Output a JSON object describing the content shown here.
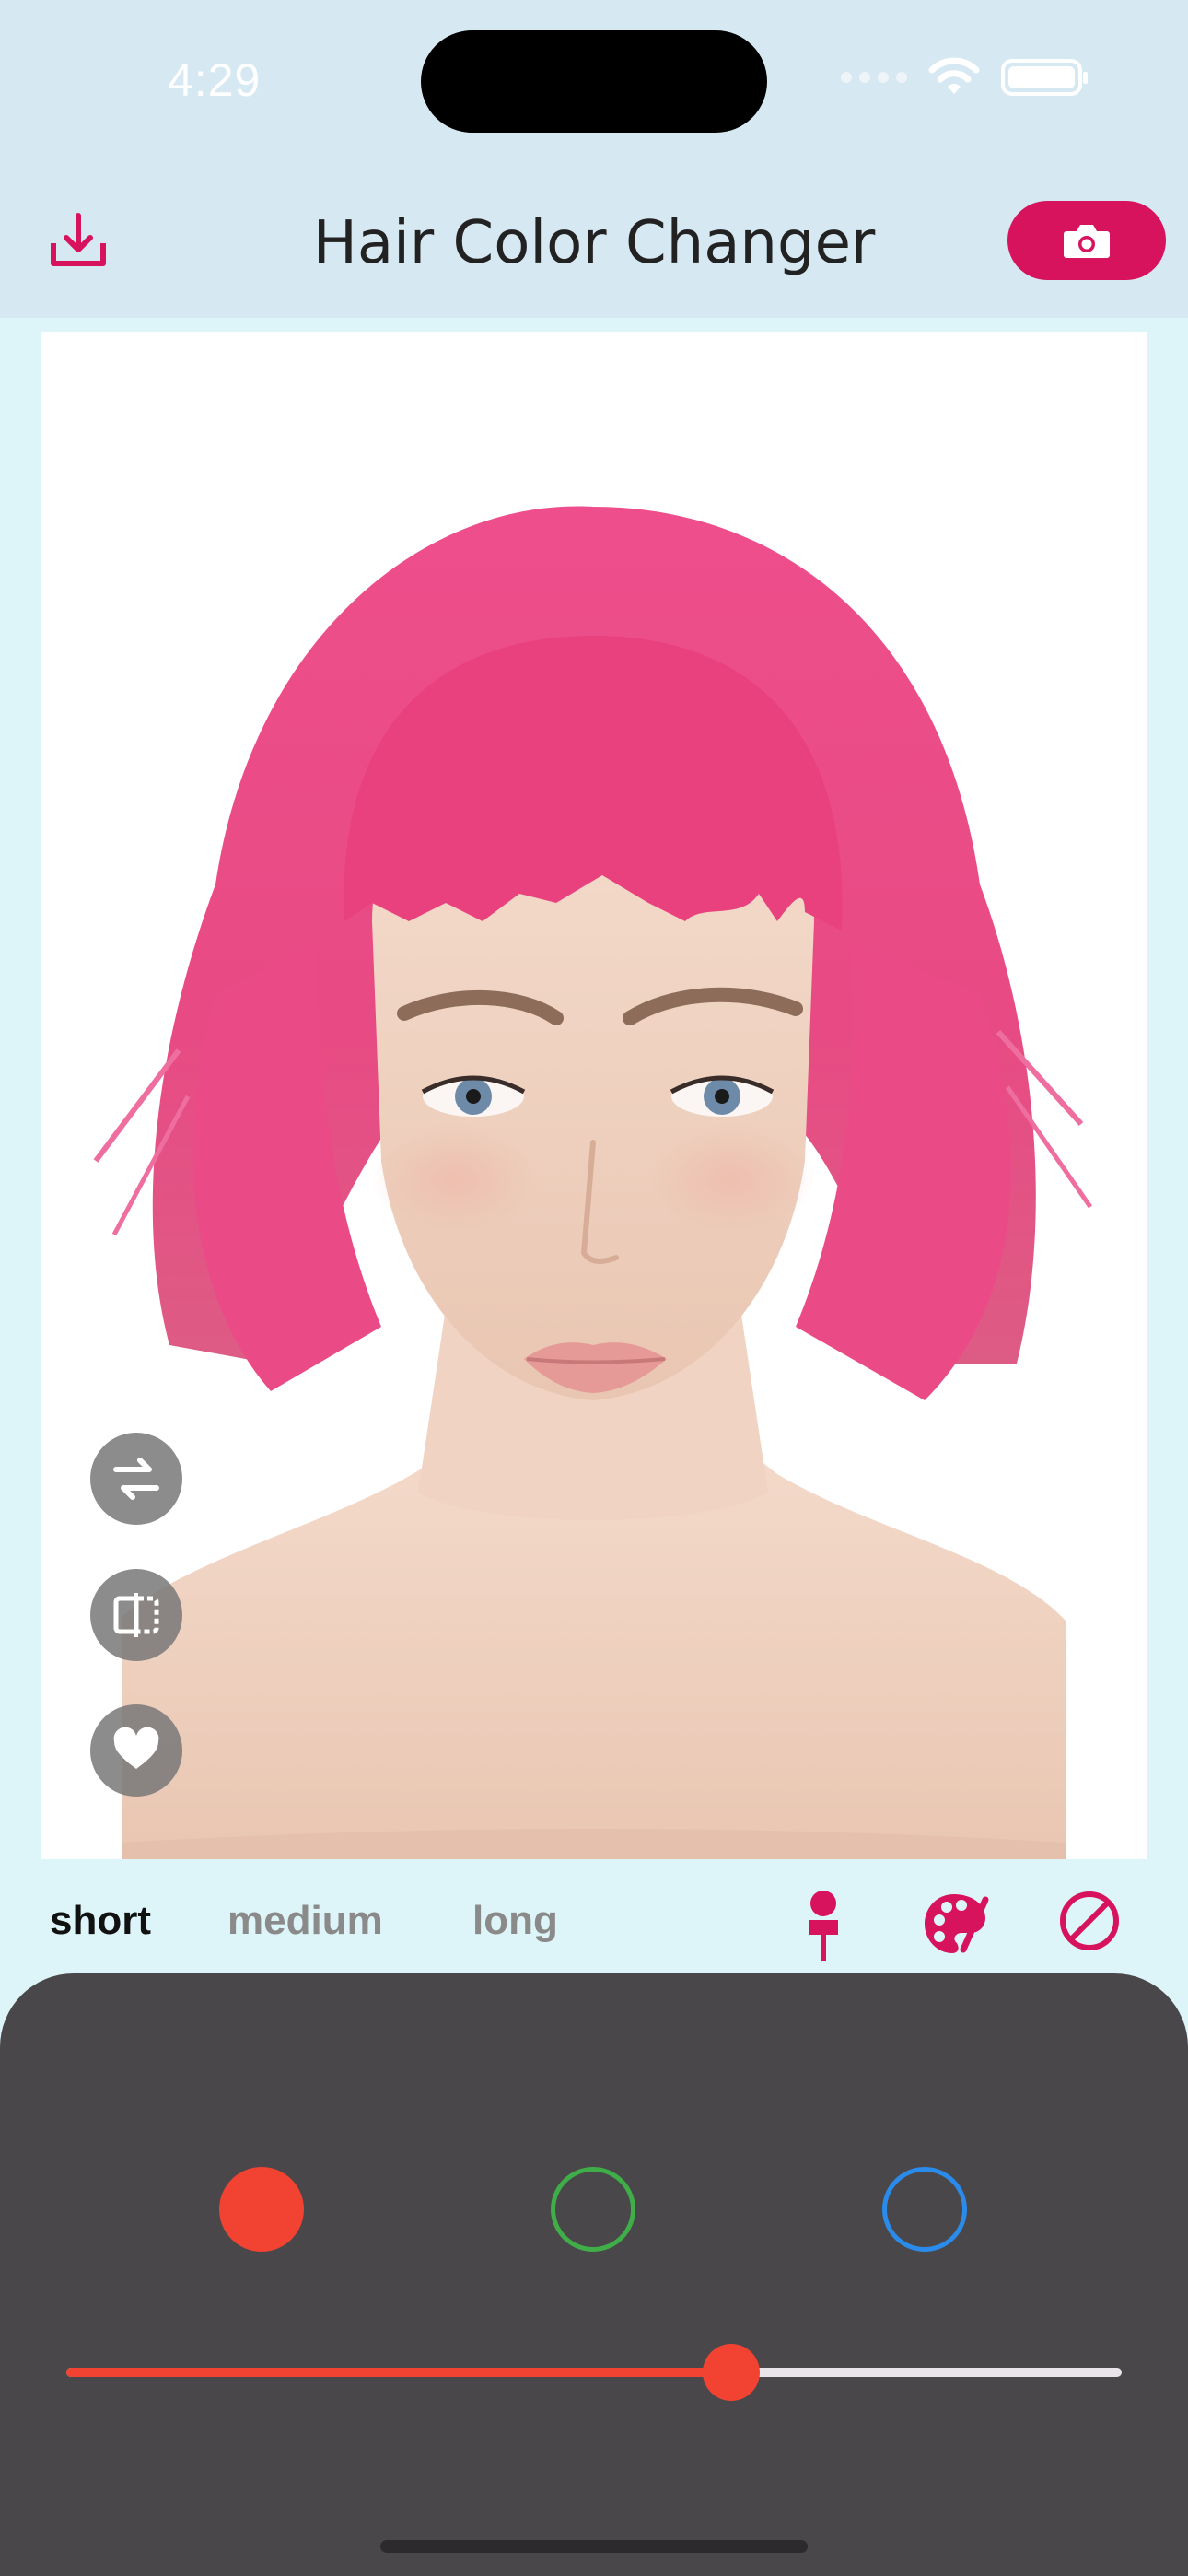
{
  "status_bar": {
    "time": "4:29"
  },
  "nav": {
    "title": "Hair Color Changer"
  },
  "icons": {
    "download": "download-icon",
    "camera": "camera-icon",
    "swap": "swap-icon",
    "compare": "compare-split-icon",
    "favorite": "heart-icon",
    "pin": "pin-icon",
    "palette": "palette-icon",
    "none": "no-color-icon"
  },
  "tabs": [
    {
      "label": "short",
      "active": true
    },
    {
      "label": "medium",
      "active": false
    },
    {
      "label": "long",
      "active": false
    }
  ],
  "swatches": [
    {
      "color": "#f24332",
      "selected": true
    },
    {
      "color": "#3fae48",
      "selected": false
    },
    {
      "color": "#2a8bea",
      "selected": false
    }
  ],
  "slider": {
    "value": 0.63
  },
  "colors": {
    "accent": "#d8135d",
    "panel": "#49474a",
    "hair": "#ea4b86"
  }
}
